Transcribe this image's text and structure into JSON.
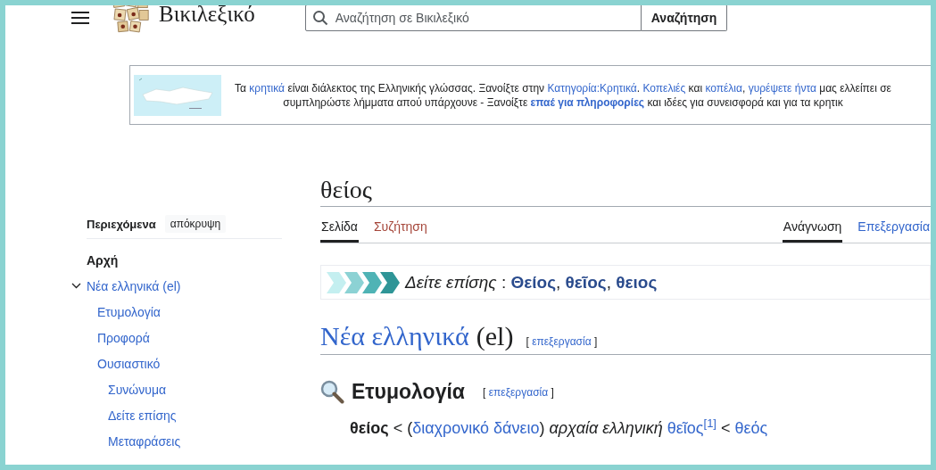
{
  "header": {
    "site_name": "Βικιλεξικό",
    "search": {
      "placeholder": "Αναζήτηση σε Βικιλεξικό"
    },
    "search_button": "Αναζήτηση"
  },
  "notice": {
    "lines": [
      [
        {
          "kind": "plain",
          "text": "Τα "
        },
        {
          "kind": "link",
          "text": "κρητικά"
        },
        {
          "kind": "plain",
          "text": " είναι διάλεκτος της Ελληνικής γλώσσας. Ξανοίξτε στην "
        },
        {
          "kind": "link",
          "text": "Κατηγορία:Κρητικά"
        },
        {
          "kind": "plain",
          "text": ". "
        },
        {
          "kind": "link",
          "text": "Κοπελιές"
        },
        {
          "kind": "plain",
          "text": " και "
        },
        {
          "kind": "link",
          "text": "κοπέλια"
        },
        {
          "kind": "plain",
          "text": ", "
        },
        {
          "kind": "link",
          "text": "γυρέψετε ήντα"
        },
        {
          "kind": "plain",
          "text": " μας ελλείπει σε"
        }
      ],
      [
        {
          "kind": "plain",
          "text": "συμπληρώστε λήμματα απού υπάρχουνε - Ξανοίξτε "
        },
        {
          "kind": "boldlink",
          "text": "επαέ για πληροφορίες"
        },
        {
          "kind": "plain",
          "text": " και ιδέες για συνεισφορά και για τα κρητικ"
        }
      ]
    ]
  },
  "toc": {
    "title": "Περιεχόμενα",
    "hide_button": "απόκρυψη",
    "items": [
      {
        "label": "Αρχή",
        "kind": "top"
      },
      {
        "label": "Νέα ελληνικά (el)",
        "kind": "section",
        "expanded": true,
        "children": [
          {
            "label": "Ετυμολογία",
            "kind": "section"
          },
          {
            "label": "Προφορά",
            "kind": "section"
          },
          {
            "label": "Ουσιαστικό",
            "kind": "section",
            "children": [
              {
                "label": "Συνώνυμα",
                "kind": "section"
              },
              {
                "label": "Δείτε επίσης",
                "kind": "section"
              },
              {
                "label": "Μεταφράσεις",
                "kind": "section"
              }
            ]
          }
        ]
      }
    ]
  },
  "page": {
    "title": "θείος",
    "tabs_left": [
      {
        "label": "Σελίδα",
        "selected": true,
        "kind": "plain"
      },
      {
        "label": "Συζήτηση",
        "selected": false,
        "kind": "missing"
      }
    ],
    "tabs_right": [
      {
        "label": "Ανάγνωση",
        "selected": true,
        "kind": "plain"
      },
      {
        "label": "Επεξεργασία",
        "selected": false,
        "kind": "link"
      }
    ],
    "see_also": [
      {
        "kind": "italic",
        "text": "Δείτε επίσης"
      },
      {
        "kind": "plain",
        "text": " : "
      },
      {
        "kind": "seelink",
        "text": "Θείος"
      },
      {
        "kind": "plain",
        "text": ", "
      },
      {
        "kind": "seelink",
        "text": "θεῖος"
      },
      {
        "kind": "plain",
        "text": ", "
      },
      {
        "kind": "seelink",
        "text": "θειος"
      }
    ],
    "language_heading": {
      "name": "Νέα ελληνικά",
      "code": "(el)",
      "edit": [
        {
          "kind": "plain",
          "text": "[ "
        },
        {
          "kind": "link",
          "text": "επεξεργασία"
        },
        {
          "kind": "plain",
          "text": " ]"
        }
      ]
    },
    "etymology": {
      "heading": "Ετυμολογία",
      "edit": [
        {
          "kind": "plain",
          "text": "[ "
        },
        {
          "kind": "link",
          "text": "επεξεργασία"
        },
        {
          "kind": "plain",
          "text": " ]"
        }
      ],
      "line": [
        {
          "kind": "bold",
          "text": "θείος"
        },
        {
          "kind": "plain",
          "text": " < ("
        },
        {
          "kind": "link",
          "text": "διαχρονικό δάνειο"
        },
        {
          "kind": "plain",
          "text": ") "
        },
        {
          "kind": "italic",
          "text": "αρχαία ελληνική "
        },
        {
          "kind": "link",
          "text": "θεῖος"
        },
        {
          "kind": "ref",
          "text": "[1]"
        },
        {
          "kind": "plain",
          "text": " < "
        },
        {
          "kind": "link",
          "text": "θεός"
        }
      ]
    }
  }
}
